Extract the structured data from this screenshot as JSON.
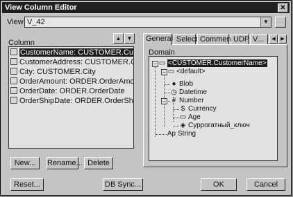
{
  "window": {
    "title": "View Column Editor",
    "close_symbol": "✕"
  },
  "view": {
    "label": "View",
    "value": "V_42",
    "drop_symbol": "▼"
  },
  "column": {
    "label": "Column",
    "items": [
      {
        "label": "CustomerName: CUSTOMER.CustomerName",
        "selected": true
      },
      {
        "label": "CustomerAddress: CUSTOMER.CustomerAddress",
        "selected": false
      },
      {
        "label": "City: CUSTOMER.City",
        "selected": false
      },
      {
        "label": "OrderAmount: ORDER.OrderAmount",
        "selected": false
      },
      {
        "label": "OrderDate: ORDER.OrderDate",
        "selected": false
      },
      {
        "label": "OrderShipDate: ORDER.OrderShipDate",
        "selected": false
      }
    ],
    "move_up_symbol": "▲",
    "move_down_symbol": "▼"
  },
  "buttons": {
    "new": "New...",
    "rename": "Rename...",
    "delete": "Delete",
    "reset": "Reset...",
    "db_sync": "DB Sync...",
    "ok": "OK",
    "cancel": "Cancel"
  },
  "tabs": {
    "items": [
      "General",
      "Select",
      "Comment",
      "UDP",
      "V..."
    ],
    "active": "General",
    "scroll_left": "◀",
    "scroll_right": "▶"
  },
  "domain": {
    "label": "Domain",
    "tree": [
      {
        "label": "<CUSTOMER.CustomerName>",
        "icon": "folder-icon",
        "glyph": "▭",
        "selected": true
      },
      {
        "label": "<default>",
        "icon": "folder-icon",
        "glyph": "▭",
        "selected": false
      },
      {
        "label": "Blob",
        "icon": "circle-icon",
        "glyph": "●",
        "selected": false
      },
      {
        "label": "Datetime",
        "icon": "clock-icon",
        "glyph": "◷",
        "selected": false
      },
      {
        "label": "Number",
        "icon": "number-icon",
        "glyph": "#",
        "selected": false
      },
      {
        "label": "Currency",
        "icon": "currency-icon",
        "glyph": "$",
        "selected": false
      },
      {
        "label": "Age",
        "icon": "folder-icon",
        "glyph": "▭",
        "selected": false
      },
      {
        "label": "Суррогатный_ключ",
        "icon": "key-icon",
        "glyph": "◈",
        "selected": false
      },
      {
        "label": "String",
        "icon": "text-icon",
        "glyph": "Ap",
        "selected": false
      }
    ]
  }
}
